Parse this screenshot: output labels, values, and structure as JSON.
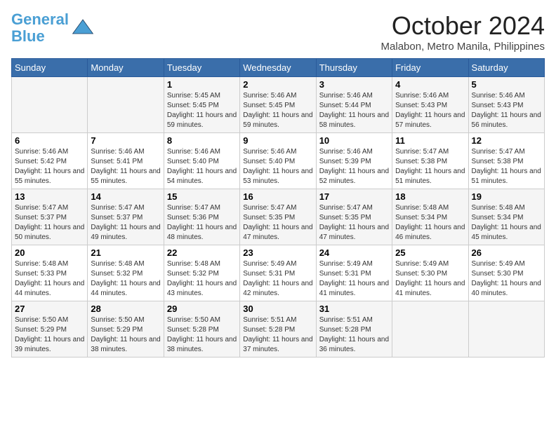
{
  "header": {
    "logo_line1": "General",
    "logo_line2": "Blue",
    "month": "October 2024",
    "location": "Malabon, Metro Manila, Philippines"
  },
  "days_of_week": [
    "Sunday",
    "Monday",
    "Tuesday",
    "Wednesday",
    "Thursday",
    "Friday",
    "Saturday"
  ],
  "weeks": [
    [
      {
        "day": "",
        "info": ""
      },
      {
        "day": "",
        "info": ""
      },
      {
        "day": "1",
        "info": "Sunrise: 5:45 AM\nSunset: 5:45 PM\nDaylight: 11 hours and 59 minutes."
      },
      {
        "day": "2",
        "info": "Sunrise: 5:46 AM\nSunset: 5:45 PM\nDaylight: 11 hours and 59 minutes."
      },
      {
        "day": "3",
        "info": "Sunrise: 5:46 AM\nSunset: 5:44 PM\nDaylight: 11 hours and 58 minutes."
      },
      {
        "day": "4",
        "info": "Sunrise: 5:46 AM\nSunset: 5:43 PM\nDaylight: 11 hours and 57 minutes."
      },
      {
        "day": "5",
        "info": "Sunrise: 5:46 AM\nSunset: 5:43 PM\nDaylight: 11 hours and 56 minutes."
      }
    ],
    [
      {
        "day": "6",
        "info": "Sunrise: 5:46 AM\nSunset: 5:42 PM\nDaylight: 11 hours and 55 minutes."
      },
      {
        "day": "7",
        "info": "Sunrise: 5:46 AM\nSunset: 5:41 PM\nDaylight: 11 hours and 55 minutes."
      },
      {
        "day": "8",
        "info": "Sunrise: 5:46 AM\nSunset: 5:40 PM\nDaylight: 11 hours and 54 minutes."
      },
      {
        "day": "9",
        "info": "Sunrise: 5:46 AM\nSunset: 5:40 PM\nDaylight: 11 hours and 53 minutes."
      },
      {
        "day": "10",
        "info": "Sunrise: 5:46 AM\nSunset: 5:39 PM\nDaylight: 11 hours and 52 minutes."
      },
      {
        "day": "11",
        "info": "Sunrise: 5:47 AM\nSunset: 5:38 PM\nDaylight: 11 hours and 51 minutes."
      },
      {
        "day": "12",
        "info": "Sunrise: 5:47 AM\nSunset: 5:38 PM\nDaylight: 11 hours and 51 minutes."
      }
    ],
    [
      {
        "day": "13",
        "info": "Sunrise: 5:47 AM\nSunset: 5:37 PM\nDaylight: 11 hours and 50 minutes."
      },
      {
        "day": "14",
        "info": "Sunrise: 5:47 AM\nSunset: 5:37 PM\nDaylight: 11 hours and 49 minutes."
      },
      {
        "day": "15",
        "info": "Sunrise: 5:47 AM\nSunset: 5:36 PM\nDaylight: 11 hours and 48 minutes."
      },
      {
        "day": "16",
        "info": "Sunrise: 5:47 AM\nSunset: 5:35 PM\nDaylight: 11 hours and 47 minutes."
      },
      {
        "day": "17",
        "info": "Sunrise: 5:47 AM\nSunset: 5:35 PM\nDaylight: 11 hours and 47 minutes."
      },
      {
        "day": "18",
        "info": "Sunrise: 5:48 AM\nSunset: 5:34 PM\nDaylight: 11 hours and 46 minutes."
      },
      {
        "day": "19",
        "info": "Sunrise: 5:48 AM\nSunset: 5:34 PM\nDaylight: 11 hours and 45 minutes."
      }
    ],
    [
      {
        "day": "20",
        "info": "Sunrise: 5:48 AM\nSunset: 5:33 PM\nDaylight: 11 hours and 44 minutes."
      },
      {
        "day": "21",
        "info": "Sunrise: 5:48 AM\nSunset: 5:32 PM\nDaylight: 11 hours and 44 minutes."
      },
      {
        "day": "22",
        "info": "Sunrise: 5:48 AM\nSunset: 5:32 PM\nDaylight: 11 hours and 43 minutes."
      },
      {
        "day": "23",
        "info": "Sunrise: 5:49 AM\nSunset: 5:31 PM\nDaylight: 11 hours and 42 minutes."
      },
      {
        "day": "24",
        "info": "Sunrise: 5:49 AM\nSunset: 5:31 PM\nDaylight: 11 hours and 41 minutes."
      },
      {
        "day": "25",
        "info": "Sunrise: 5:49 AM\nSunset: 5:30 PM\nDaylight: 11 hours and 41 minutes."
      },
      {
        "day": "26",
        "info": "Sunrise: 5:49 AM\nSunset: 5:30 PM\nDaylight: 11 hours and 40 minutes."
      }
    ],
    [
      {
        "day": "27",
        "info": "Sunrise: 5:50 AM\nSunset: 5:29 PM\nDaylight: 11 hours and 39 minutes."
      },
      {
        "day": "28",
        "info": "Sunrise: 5:50 AM\nSunset: 5:29 PM\nDaylight: 11 hours and 38 minutes."
      },
      {
        "day": "29",
        "info": "Sunrise: 5:50 AM\nSunset: 5:28 PM\nDaylight: 11 hours and 38 minutes."
      },
      {
        "day": "30",
        "info": "Sunrise: 5:51 AM\nSunset: 5:28 PM\nDaylight: 11 hours and 37 minutes."
      },
      {
        "day": "31",
        "info": "Sunrise: 5:51 AM\nSunset: 5:28 PM\nDaylight: 11 hours and 36 minutes."
      },
      {
        "day": "",
        "info": ""
      },
      {
        "day": "",
        "info": ""
      }
    ]
  ]
}
